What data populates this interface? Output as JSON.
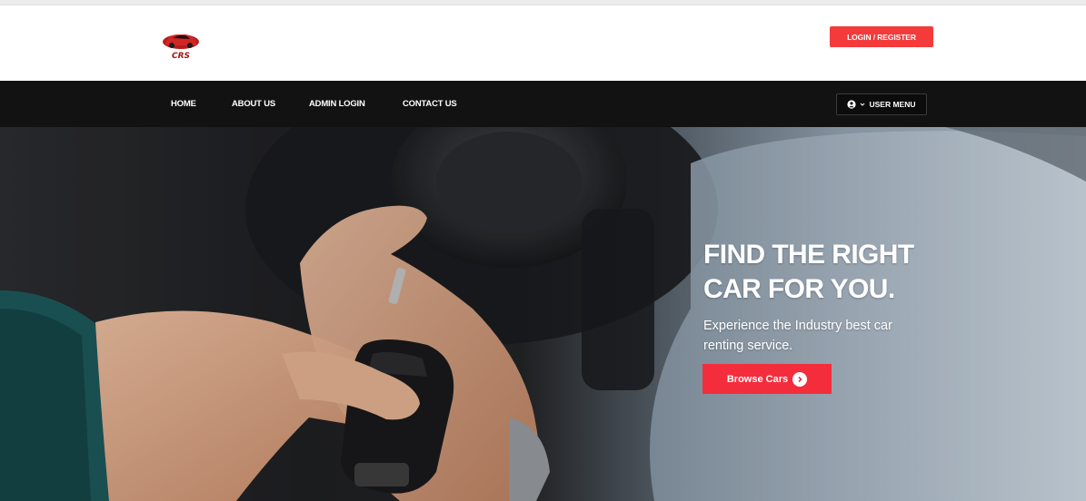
{
  "brand": {
    "logo_text": "CRS",
    "logo_icon": "red-car-logo",
    "colors": {
      "accent": "#f43a3a",
      "nav_bg": "#121212"
    }
  },
  "header": {
    "login_label": "LOGIN / REGISTER"
  },
  "nav": {
    "items": [
      {
        "label": "HOME"
      },
      {
        "label": "ABOUT US"
      },
      {
        "label": "ADMIN LOGIN"
      },
      {
        "label": "CONTACT US"
      }
    ],
    "user_menu": {
      "label": "USER MENU",
      "icon": "user-circle-icon",
      "caret_icon": "chevron-down-icon"
    }
  },
  "hero": {
    "title_line1": "FIND THE RIGHT",
    "title_line2": "CAR FOR YOU.",
    "subtitle_line1": "Experience the Industry best car",
    "subtitle_line2": "renting service.",
    "cta_label": "Browse Cars",
    "cta_icon": "arrow-right-circle-icon"
  }
}
